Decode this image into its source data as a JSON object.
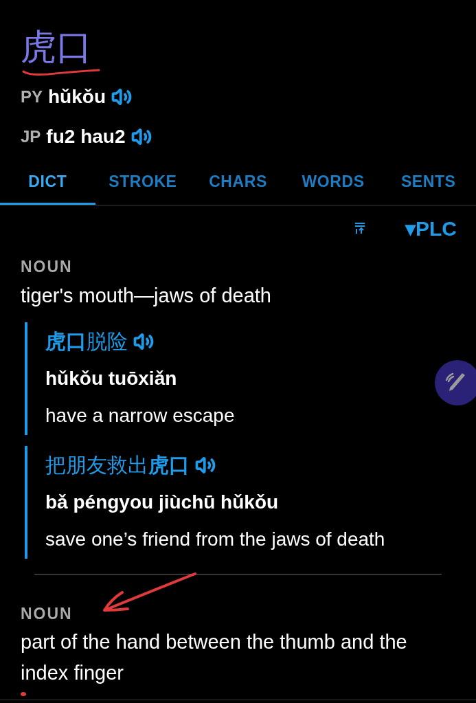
{
  "headword": "虎口",
  "readings": [
    {
      "label": "PY",
      "text": "hǔkǒu"
    },
    {
      "label": "JP",
      "text": "fu2 hau2"
    }
  ],
  "tabs": [
    {
      "label": "DICT",
      "selected": true
    },
    {
      "label": "STROKE",
      "selected": false
    },
    {
      "label": "CHARS",
      "selected": false
    },
    {
      "label": "WORDS",
      "selected": false
    },
    {
      "label": "SENTS",
      "selected": false
    }
  ],
  "toolbar": {
    "dropdown": "▾PLC"
  },
  "senses": [
    {
      "pos": "NOUN",
      "definition": "tiger's mouth—jaws of death",
      "examples": [
        {
          "hanzi": "**虎口**脱险",
          "pinyin": "hǔkǒu tuōxiǎn",
          "translation": "have a narrow escape"
        },
        {
          "hanzi": "把朋友救出**虎口**",
          "pinyin": "bǎ péngyou jiùchū hǔkǒu",
          "translation": "save one’s friend from the jaws of death"
        }
      ]
    },
    {
      "pos": "NOUN",
      "definition": "part of the hand between the thumb and the index finger"
    }
  ]
}
